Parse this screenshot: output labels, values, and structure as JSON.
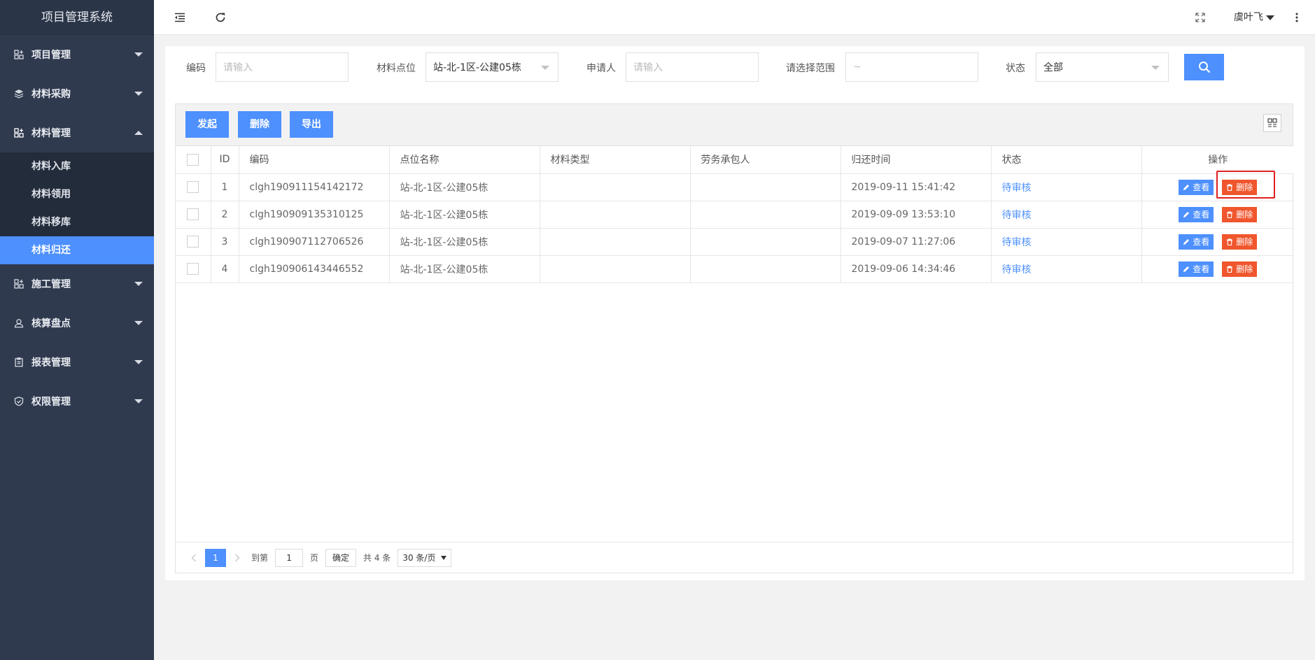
{
  "app": {
    "title": "项目管理系统"
  },
  "sidebar": {
    "groups": [
      {
        "label": "项目管理",
        "icon": "grid-plus-icon",
        "expanded": false
      },
      {
        "label": "材料采购",
        "icon": "layers-icon",
        "expanded": false
      },
      {
        "label": "材料管理",
        "icon": "grid-plus-icon",
        "expanded": true,
        "items": [
          {
            "label": "材料入库",
            "active": false
          },
          {
            "label": "材料领用",
            "active": false
          },
          {
            "label": "材料移库",
            "active": false
          },
          {
            "label": "材料归还",
            "active": true
          }
        ]
      },
      {
        "label": "施工管理",
        "icon": "grid-plus-icon",
        "expanded": false
      },
      {
        "label": "核算盘点",
        "icon": "user-icon",
        "expanded": false
      },
      {
        "label": "报表管理",
        "icon": "clipboard-icon",
        "expanded": false
      },
      {
        "label": "权限管理",
        "icon": "shield-check-icon",
        "expanded": false
      }
    ]
  },
  "header": {
    "user_name": "虞叶飞"
  },
  "filters": {
    "code_label": "编码",
    "code_placeholder": "请输入",
    "location_label": "材料点位",
    "location_value": "站-北-1区-公建05栋",
    "applicant_label": "申请人",
    "applicant_placeholder": "请输入",
    "range_label": "请选择范围",
    "range_placeholder": "~",
    "status_label": "状态",
    "status_value": "全部"
  },
  "toolbar": {
    "initiate_label": "发起",
    "delete_label": "删除",
    "export_label": "导出"
  },
  "table": {
    "columns": [
      "ID",
      "编码",
      "点位名称",
      "材料类型",
      "劳务承包人",
      "归还时间",
      "状态",
      "操作"
    ],
    "rows": [
      {
        "id": "1",
        "code": "clgh190911154142172",
        "location": "站-北-1区-公建05栋",
        "material_type": "",
        "contractor": "",
        "return_time": "2019-09-11 15:41:42",
        "status": "待审核"
      },
      {
        "id": "2",
        "code": "clgh190909135310125",
        "location": "站-北-1区-公建05栋",
        "material_type": "",
        "contractor": "",
        "return_time": "2019-09-09 13:53:10",
        "status": "待审核"
      },
      {
        "id": "3",
        "code": "clgh190907112706526",
        "location": "站-北-1区-公建05栋",
        "material_type": "",
        "contractor": "",
        "return_time": "2019-09-07 11:27:06",
        "status": "待审核"
      },
      {
        "id": "4",
        "code": "clgh190906143446552",
        "location": "站-北-1区-公建05栋",
        "material_type": "",
        "contractor": "",
        "return_time": "2019-09-06 14:34:46",
        "status": "待审核"
      }
    ],
    "view_label": "查看",
    "delete_label": "删除"
  },
  "pagination": {
    "current_page": "1",
    "goto_label": "到第",
    "goto_value": "1",
    "page_unit": "页",
    "confirm_label": "确定",
    "total_text": "共 4 条",
    "page_size": "30 条/页"
  },
  "colors": {
    "sidebar_bg": "#2f3a4f",
    "accent": "#4d90fe",
    "danger": "#f0562d",
    "highlight": "#e02020"
  }
}
